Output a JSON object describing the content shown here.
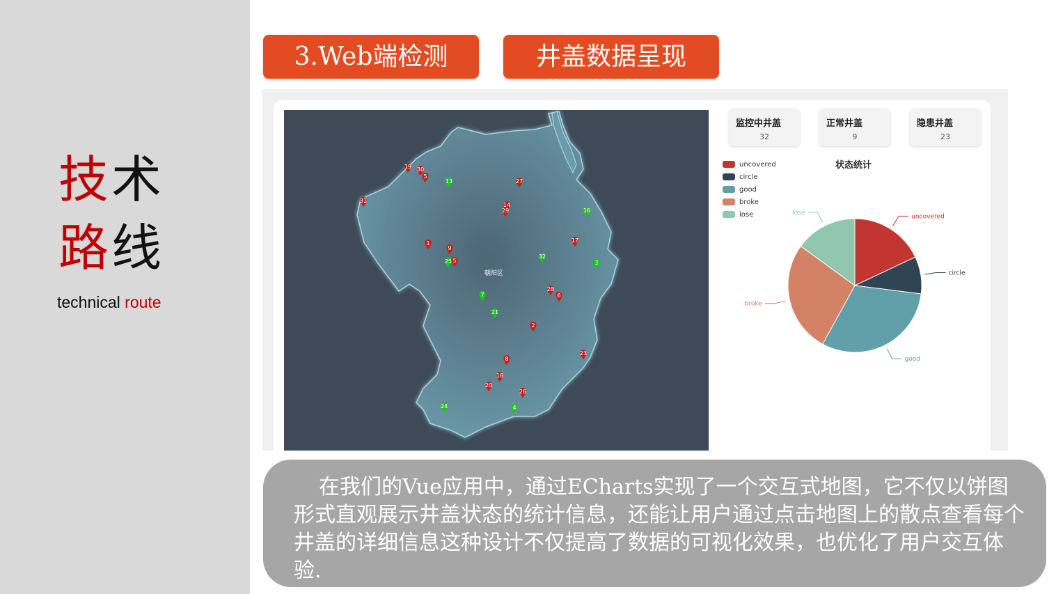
{
  "sidebar": {
    "title_part1": "技",
    "title_part2": "术",
    "title_part3": "路",
    "title_part4": "线",
    "subtitle_part1": "technical",
    "subtitle_part2": "route"
  },
  "header": {
    "pill_left": "3.Web端检测",
    "pill_right": "井盖数据呈现"
  },
  "app": {
    "map_district_label": "朝阳区",
    "cards": [
      {
        "title": "监控中井盖",
        "value": "32"
      },
      {
        "title": "正常井盖",
        "value": "9"
      },
      {
        "title": "隐患井盖",
        "value": "23"
      }
    ],
    "legend": [
      {
        "label": "uncovered",
        "color": "#c23531"
      },
      {
        "label": "circle",
        "color": "#2f4554"
      },
      {
        "label": "good",
        "color": "#61a0a8"
      },
      {
        "label": "broke",
        "color": "#d48265"
      },
      {
        "label": "lose",
        "color": "#91c7ae"
      }
    ],
    "pie_title": "状态统计",
    "markers": [
      {
        "id": "19",
        "status": "red"
      },
      {
        "id": "30",
        "status": "red"
      },
      {
        "id": "5",
        "status": "red"
      },
      {
        "id": "13",
        "status": "green"
      },
      {
        "id": "27",
        "status": "red"
      },
      {
        "id": "31",
        "status": "red"
      },
      {
        "id": "14",
        "status": "red"
      },
      {
        "id": "29",
        "status": "red"
      },
      {
        "id": "16",
        "status": "green"
      },
      {
        "id": "1",
        "status": "red"
      },
      {
        "id": "9",
        "status": "red"
      },
      {
        "id": "17",
        "status": "red"
      },
      {
        "id": "25",
        "status": "green"
      },
      {
        "id": "5",
        "status": "red"
      },
      {
        "id": "32",
        "status": "green"
      },
      {
        "id": "3",
        "status": "green"
      },
      {
        "id": "7",
        "status": "green"
      },
      {
        "id": "28",
        "status": "red"
      },
      {
        "id": "6",
        "status": "red"
      },
      {
        "id": "21",
        "status": "green"
      },
      {
        "id": "2",
        "status": "red"
      },
      {
        "id": "23",
        "status": "red"
      },
      {
        "id": "8",
        "status": "red"
      },
      {
        "id": "18",
        "status": "red"
      },
      {
        "id": "20",
        "status": "red"
      },
      {
        "id": "26",
        "status": "red"
      },
      {
        "id": "24",
        "status": "green"
      },
      {
        "id": "4",
        "status": "green"
      }
    ]
  },
  "description": {
    "text": "在我们的Vue应用中，通过ECharts实现了一个交互式地图，它不仅以饼图形式直观展示井盖状态的统计信息，还能让用户通过点击地图上的散点查看每个井盖的详细信息这种设计不仅提高了数据的可视化效果，也优化了用户交互体验."
  },
  "chart_data": {
    "type": "pie",
    "title": "状态统计",
    "categories": [
      "uncovered",
      "circle",
      "good",
      "broke",
      "lose"
    ],
    "values": [
      18,
      9,
      31,
      27,
      15
    ]
  }
}
